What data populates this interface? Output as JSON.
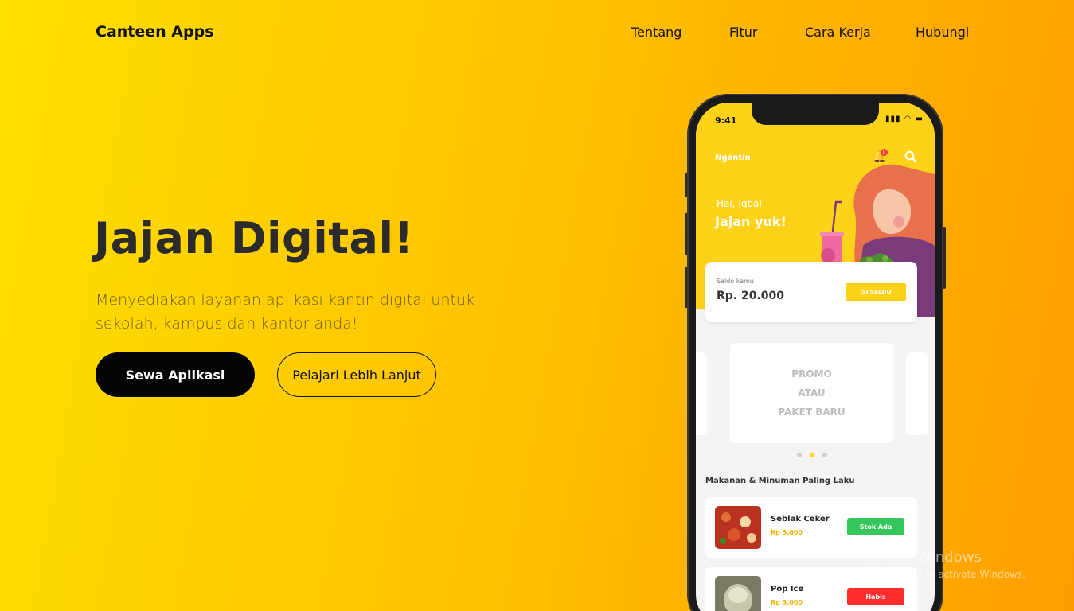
{
  "header": {
    "brand": "Canteen Apps",
    "nav": [
      "Tentang",
      "Fitur",
      "Cara Kerja",
      "Hubungi"
    ]
  },
  "hero": {
    "title": "Jajan Digital!",
    "subtitle": "Menyediakan layanan aplikasi kantin digital untuk sekolah, kampus dan kantor anda!",
    "primary_button": "Sewa Aplikasi",
    "secondary_button": "Pelajari Lebih Lanjut"
  },
  "phone": {
    "time": "9:41",
    "status_icons": "▮▮▮ ◠ ▬",
    "app_name": "Ngantin",
    "notification_count": "0",
    "greeting": "Hai, Iqbal",
    "greeting_cta": "Jajan yuk!",
    "balance": {
      "label": "Saldo kamu",
      "value": "Rp. 20.000",
      "button": "ISI SALDO"
    },
    "promo": {
      "line1": "PROMO",
      "line2": "ATAU",
      "line3": "PAKET BARU"
    },
    "carousel_active_index": 1,
    "section_title": "Makanan & Minuman Paling Laku",
    "items": [
      {
        "name": "Seblak Ceker",
        "price": "Rp 5.000",
        "status": "Stok Ada",
        "status_color": "#34c759"
      },
      {
        "name": "Pop Ice",
        "price": "Rp 3.000",
        "status": "Habis",
        "status_color": "#ff2d2d"
      }
    ],
    "colors": {
      "accent": "#ffd21a",
      "price": "#f5b400"
    }
  },
  "watermark": {
    "title": "Activate Windows",
    "subtitle": "Go to Settings to activate Windows."
  }
}
